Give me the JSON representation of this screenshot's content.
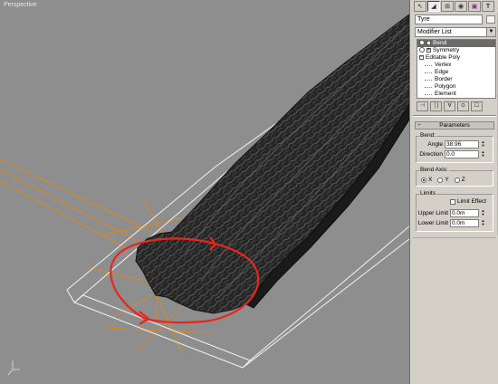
{
  "viewport": {
    "label": "Perspective"
  },
  "panel": {
    "tabs": [
      {
        "name": "create-tab",
        "glyph": "↖"
      },
      {
        "name": "modify-tab",
        "glyph": "◢"
      },
      {
        "name": "hierarchy-tab",
        "glyph": "⊞"
      },
      {
        "name": "motion-tab",
        "glyph": "◉"
      },
      {
        "name": "display-tab",
        "glyph": "▣"
      },
      {
        "name": "utilities-tab",
        "glyph": "T"
      }
    ],
    "object_name": "Tyre",
    "object_color": "#f5f5f5",
    "modifier_list": "Modifier List",
    "stack": {
      "bend": "Bend",
      "symmetry": "Symmetry",
      "editable_poly": "Editable Poly",
      "vertex": "Vertex",
      "edge": "Edge",
      "border": "Border",
      "polygon": "Polygon",
      "element": "Element"
    },
    "stack_tools": [
      "⊣",
      "│|",
      "∀",
      "⊙",
      "☐"
    ]
  },
  "parameters": {
    "title": "Parameters",
    "bend_group": "Bend:",
    "angle_label": "Angle",
    "angle_value": "38.96",
    "direction_label": "Direction",
    "direction_value": "0.0",
    "axis_group": "Bend Axis:",
    "axis_x": "X",
    "axis_y": "Y",
    "axis_z": "Z",
    "limits_group": "Limits",
    "limit_effect": "Limit Effect",
    "upper_label": "Upper Limit",
    "upper_value": "0.0m",
    "lower_label": "Lower Limit",
    "lower_value": "0.0m"
  },
  "colors": {
    "annotation": "#e8261b",
    "gizmo": "#d98a1e",
    "viewport_bg": "#8e8e8e",
    "panel_bg": "#d4d0c8"
  }
}
